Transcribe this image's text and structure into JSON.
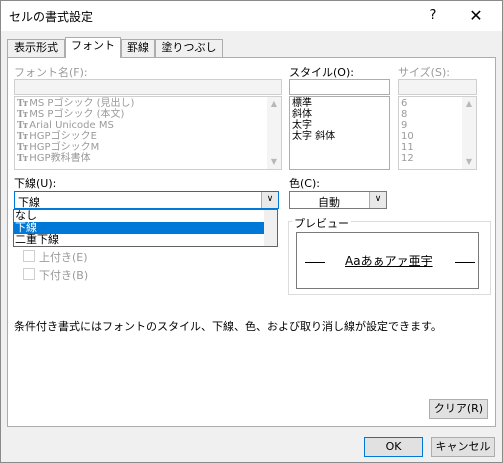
{
  "window": {
    "title": "セルの書式設定",
    "help": "?",
    "close": "✕"
  },
  "tabs": [
    "表示形式",
    "フォント",
    "罫線",
    "塗りつぶし"
  ],
  "font_name": {
    "label": "フォント名(F):",
    "value": "",
    "items": [
      "MS Pゴシック (見出し)",
      "MS Pゴシック (本文)",
      "Arial Unicode MS",
      "HGPゴシックE",
      "HGPゴシックM",
      "HGP教科書体"
    ],
    "item_icon": "truetype-icon"
  },
  "style": {
    "label": "スタイル(O):",
    "value": "",
    "items": [
      "標準",
      "斜体",
      "太字",
      "太字 斜体"
    ]
  },
  "size": {
    "label": "サイズ(S):",
    "value": "",
    "items": [
      "6",
      "8",
      "9",
      "10",
      "11",
      "12"
    ]
  },
  "underline": {
    "label": "下線(U):",
    "value": "下線",
    "options": [
      "なし",
      "下線",
      "二重下線"
    ],
    "selected_index": 1
  },
  "color": {
    "label": "色(C):",
    "value": "自動"
  },
  "effects": {
    "superscript": "上付き(E)",
    "subscript": "下付き(B)"
  },
  "preview": {
    "title": "プレビュー",
    "sample": "Aaあぁアァ亜宇"
  },
  "note": "条件付き書式にはフォントのスタイル、下線、色、および取り消し線が設定できます。",
  "buttons": {
    "clear": "クリア(R)",
    "ok": "OK",
    "cancel": "キャンセル"
  },
  "colors": {
    "selection": "#0078d7",
    "default_button_border": "#0078d7"
  }
}
